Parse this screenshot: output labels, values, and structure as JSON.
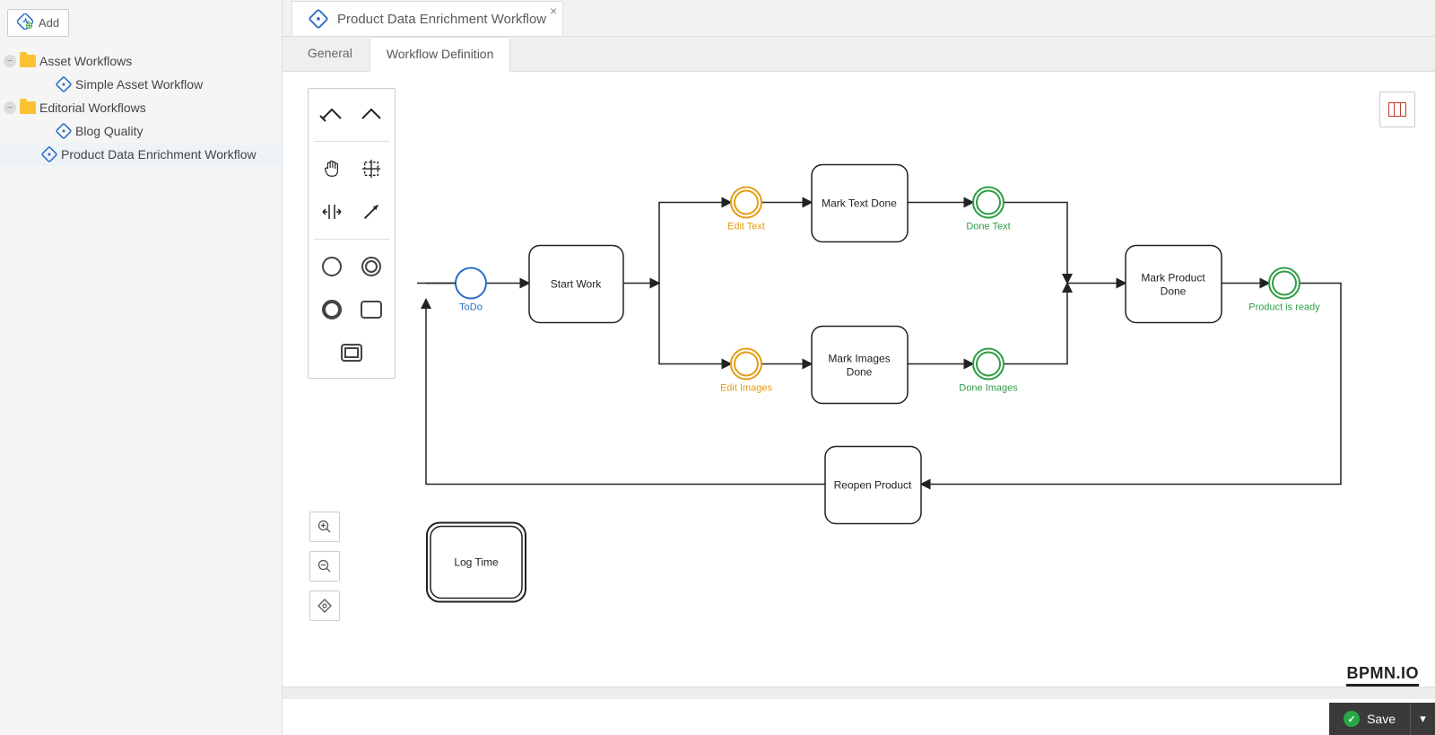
{
  "sidebar": {
    "add_label": "Add",
    "folders": [
      {
        "label": "Asset Workflows",
        "items": [
          {
            "label": "Simple Asset Workflow"
          }
        ]
      },
      {
        "label": "Editorial Workflows",
        "items": [
          {
            "label": "Blog Quality"
          },
          {
            "label": "Product Data Enrichment Workflow"
          }
        ]
      }
    ]
  },
  "tab": {
    "title": "Product Data Enrichment Workflow",
    "close": "×"
  },
  "subtabs": {
    "general": "General",
    "definition": "Workflow Definition"
  },
  "diagram": {
    "events": {
      "todo": "ToDo",
      "edit_text": "Edit Text",
      "edit_images": "Edit Images",
      "done_text": "Done Text",
      "done_images": "Done Images",
      "product_ready": "Product is ready"
    },
    "tasks": {
      "start_work": "Start Work",
      "mark_text_done": "Mark Text Done",
      "mark_images_done_l1": "Mark Images",
      "mark_images_done_l2": "Done",
      "mark_product_done_l1": "Mark Product",
      "mark_product_done_l2": "Done",
      "reopen": "Reopen Product",
      "log_time": "Log Time"
    }
  },
  "brand": "BPMN.IO",
  "save": "Save"
}
